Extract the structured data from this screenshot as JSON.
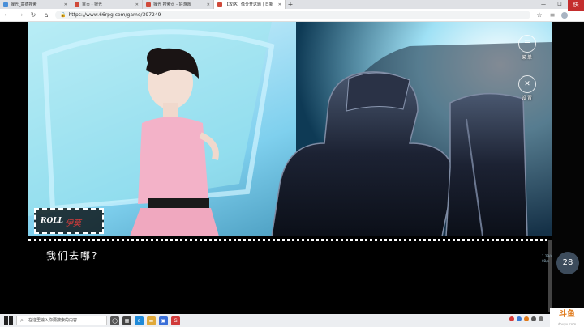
{
  "tabs": [
    {
      "title": "狸光_高德搜索",
      "color": "#4a8fd8",
      "active": false
    },
    {
      "title": "首页 - 狸光",
      "color": "#d04a3a",
      "active": false
    },
    {
      "title": "狸光 搜索页 - 好游戏",
      "color": "#d04a3a",
      "active": false
    },
    {
      "title": "【攻略】像分开这题 | 日新",
      "color": "#d04a3a",
      "active": true
    }
  ],
  "address": {
    "url": "https://www.66rpg.com/game/397249"
  },
  "game": {
    "menu_top": {
      "icon": "menu-icon",
      "label": "菜单"
    },
    "menu_settings": {
      "icon": "settings-icon",
      "label": "设置"
    },
    "namebox": {
      "roll": "ROLL",
      "name": "伊莫"
    },
    "dialog": "我们去哪?",
    "counter": "28",
    "speed_up": "1.2B/s",
    "speed_down": "0B/s",
    "corner_tag": "快"
  },
  "taskbar": {
    "search_placeholder": "在这里输入你要搜索的内容"
  },
  "watermark": {
    "brand": "斗鱼",
    "sub": "douyu.com"
  }
}
